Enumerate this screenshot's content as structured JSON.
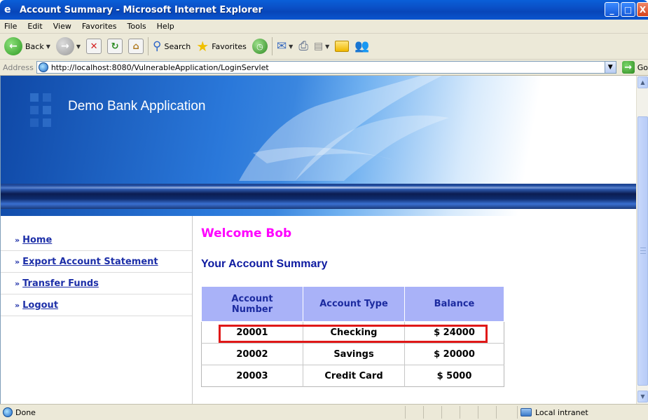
{
  "window": {
    "title": "Account Summary - Microsoft Internet Explorer",
    "minimize": "_",
    "maximize": "□",
    "close": "X"
  },
  "menu": [
    "File",
    "Edit",
    "View",
    "Favorites",
    "Tools",
    "Help"
  ],
  "toolbar": {
    "back_label": "Back",
    "search_label": "Search",
    "favorites_label": "Favorites"
  },
  "address": {
    "label": "Address",
    "url": "http://localhost:8080/VulnerableApplication/LoginServlet",
    "go_label": "Go"
  },
  "banner": {
    "title": "Demo Bank Application"
  },
  "nav": {
    "arrow": "»",
    "items": [
      "Home",
      "Export Account Statement",
      "Transfer Funds",
      "Logout"
    ]
  },
  "main": {
    "welcome": "Welcome Bob",
    "summary_title": "Your Account Summary",
    "table": {
      "headers": [
        "Account\nNumber",
        "Account Type",
        "Balance"
      ],
      "rows": [
        [
          "20001",
          "Checking",
          "$ 24000"
        ],
        [
          "20002",
          "Savings",
          "$ 20000"
        ],
        [
          "20003",
          "Credit Card",
          "$ 5000"
        ]
      ]
    }
  },
  "status": {
    "text": "Done",
    "zone": "Local intranet"
  },
  "colors": {
    "welcome": "#ff00ff",
    "summary_title": "#0d1aa0",
    "nav_link": "#1d2fa8",
    "table_header_bg": "#a9b2f8",
    "highlight_box": "#e01818"
  }
}
